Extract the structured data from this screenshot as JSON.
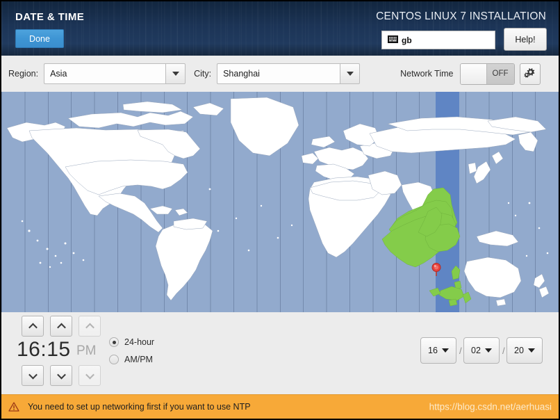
{
  "header": {
    "title": "DATE & TIME",
    "done_label": "Done",
    "install_title": "CENTOS LINUX 7 INSTALLATION",
    "keyboard_layout": "gb",
    "keyboard_icon": "keyboard-icon",
    "help_label": "Help!"
  },
  "toolbar": {
    "region_label": "Region:",
    "region_value": "Asia",
    "city_label": "City:",
    "city_value": "Shanghai",
    "network_time_label": "Network Time",
    "network_time_state": "OFF",
    "config_icon": "gear-icon"
  },
  "map": {
    "ocean_color": "#92aacd",
    "land_color": "#ffffff",
    "highlight_color": "#84cc4a",
    "band_color": "#5f85c4",
    "pin_color": "#e8413c",
    "pin_icon": "map-pin-icon",
    "selected_timezone": "Asia/Shanghai"
  },
  "time": {
    "hour": "16",
    "minute": "15",
    "separator": ":",
    "display": "16:15",
    "ampm": "PM",
    "ampm_enabled": false,
    "format_options": [
      {
        "label": "24-hour",
        "selected": true
      },
      {
        "label": "AM/PM",
        "selected": false
      }
    ],
    "up_icon": "chevron-up-icon",
    "down_icon": "chevron-down-icon"
  },
  "date": {
    "day": "16",
    "month": "02",
    "year": "20",
    "separator": "/"
  },
  "warning": {
    "icon": "warning-triangle-icon",
    "text": "You need to set up networking first if you want to use NTP",
    "watermark": "https://blog.csdn.net/aerhuasi",
    "bar_color": "#f7a938"
  }
}
